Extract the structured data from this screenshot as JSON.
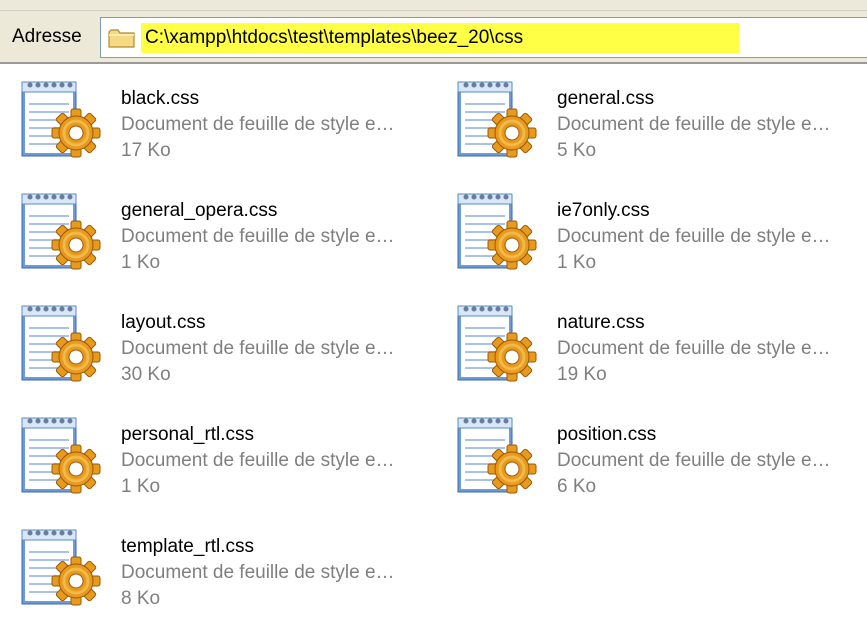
{
  "address_bar": {
    "label": "Adresse",
    "path": "C:\\xampp\\htdocs\\test\\templates\\beez_20\\css",
    "highlight_color": "#ffff46",
    "folder_icon": "folder-icon"
  },
  "files": [
    {
      "name": "black.css",
      "type": "Document de feuille de style e…",
      "size": "17 Ko",
      "icon": "css-document-icon"
    },
    {
      "name": "general.css",
      "type": "Document de feuille de style e…",
      "size": "5 Ko",
      "icon": "css-document-icon"
    },
    {
      "name": "general_opera.css",
      "type": "Document de feuille de style e…",
      "size": "1 Ko",
      "icon": "css-document-icon"
    },
    {
      "name": "ie7only.css",
      "type": "Document de feuille de style e…",
      "size": "1 Ko",
      "icon": "css-document-icon"
    },
    {
      "name": "layout.css",
      "type": "Document de feuille de style e…",
      "size": "30 Ko",
      "icon": "css-document-icon"
    },
    {
      "name": "nature.css",
      "type": "Document de feuille de style e…",
      "size": "19 Ko",
      "icon": "css-document-icon"
    },
    {
      "name": "personal_rtl.css",
      "type": "Document de feuille de style e…",
      "size": "1 Ko",
      "icon": "css-document-icon"
    },
    {
      "name": "position.css",
      "type": "Document de feuille de style e…",
      "size": "6 Ko",
      "icon": "css-document-icon"
    },
    {
      "name": "template_rtl.css",
      "type": "Document de feuille de style e…",
      "size": "8 Ko",
      "icon": "css-document-icon"
    }
  ]
}
